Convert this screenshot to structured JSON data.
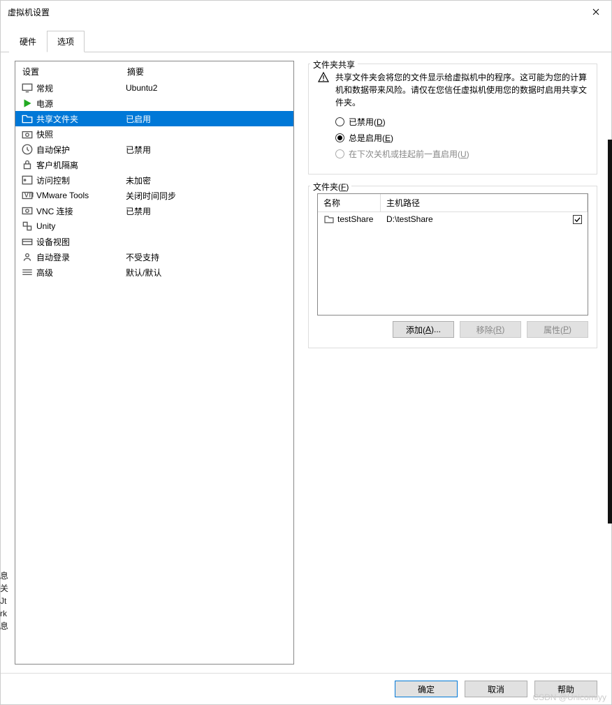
{
  "window": {
    "title": "虚拟机设置"
  },
  "tabs": [
    {
      "label": "硬件",
      "active": false
    },
    {
      "label": "选项",
      "active": true
    }
  ],
  "settings_header": {
    "col1": "设置",
    "col2": "摘要"
  },
  "settings": [
    {
      "icon": "monitor",
      "label": "常规",
      "summary": "Ubuntu2",
      "selected": false
    },
    {
      "icon": "play",
      "label": "电源",
      "summary": "",
      "selected": false
    },
    {
      "icon": "folder-share",
      "label": "共享文件夹",
      "summary": "已启用",
      "selected": true
    },
    {
      "icon": "camera",
      "label": "快照",
      "summary": "",
      "selected": false
    },
    {
      "icon": "clock",
      "label": "自动保护",
      "summary": "已禁用",
      "selected": false
    },
    {
      "icon": "lock",
      "label": "客户机隔离",
      "summary": "",
      "selected": false
    },
    {
      "icon": "key",
      "label": "访问控制",
      "summary": "未加密",
      "selected": false
    },
    {
      "icon": "vm",
      "label": "VMware Tools",
      "summary": "关闭时间同步",
      "selected": false
    },
    {
      "icon": "vnc",
      "label": "VNC 连接",
      "summary": "已禁用",
      "selected": false
    },
    {
      "icon": "unity",
      "label": "Unity",
      "summary": "",
      "selected": false
    },
    {
      "icon": "device",
      "label": "设备视图",
      "summary": "",
      "selected": false
    },
    {
      "icon": "login",
      "label": "自动登录",
      "summary": "不受支持",
      "selected": false
    },
    {
      "icon": "advanced",
      "label": "高级",
      "summary": "默认/默认",
      "selected": false
    }
  ],
  "share_panel": {
    "legend": "文件夹共享",
    "warning": "共享文件夹会将您的文件显示给虚拟机中的程序。这可能为您的计算机和数据带来风险。请仅在您信任虚拟机使用您的数据时启用共享文件夹。",
    "radios": {
      "disabled": {
        "label_pre": "已禁用(",
        "hotkey": "D",
        "label_post": ")",
        "checked": false,
        "disabled": false
      },
      "always": {
        "label_pre": "总是启用(",
        "hotkey": "E",
        "label_post": ")",
        "checked": true,
        "disabled": false
      },
      "until": {
        "label_pre": "在下次关机或挂起前一直启用(",
        "hotkey": "U",
        "label_post": ")",
        "checked": false,
        "disabled": true
      }
    }
  },
  "folders_panel": {
    "legend_pre": "文件夹(",
    "legend_hot": "F",
    "legend_post": ")",
    "header": {
      "name": "名称",
      "path": "主机路径"
    },
    "rows": [
      {
        "name": "testShare",
        "path": "D:\\testShare",
        "enabled": true
      }
    ],
    "buttons": {
      "add": {
        "pre": "添加(",
        "hot": "A",
        "post": ")...",
        "disabled": false
      },
      "remove": {
        "pre": "移除(",
        "hot": "R",
        "post": ")",
        "disabled": true
      },
      "props": {
        "pre": "属性(",
        "hot": "P",
        "post": ")",
        "disabled": true
      }
    }
  },
  "footer": {
    "ok": "确定",
    "cancel": "取消",
    "help": "帮助"
  },
  "left_strip": [
    "息",
    "关",
    "Jt",
    "rk",
    "息"
  ],
  "watermark": "CSDN @Unicornlyy"
}
